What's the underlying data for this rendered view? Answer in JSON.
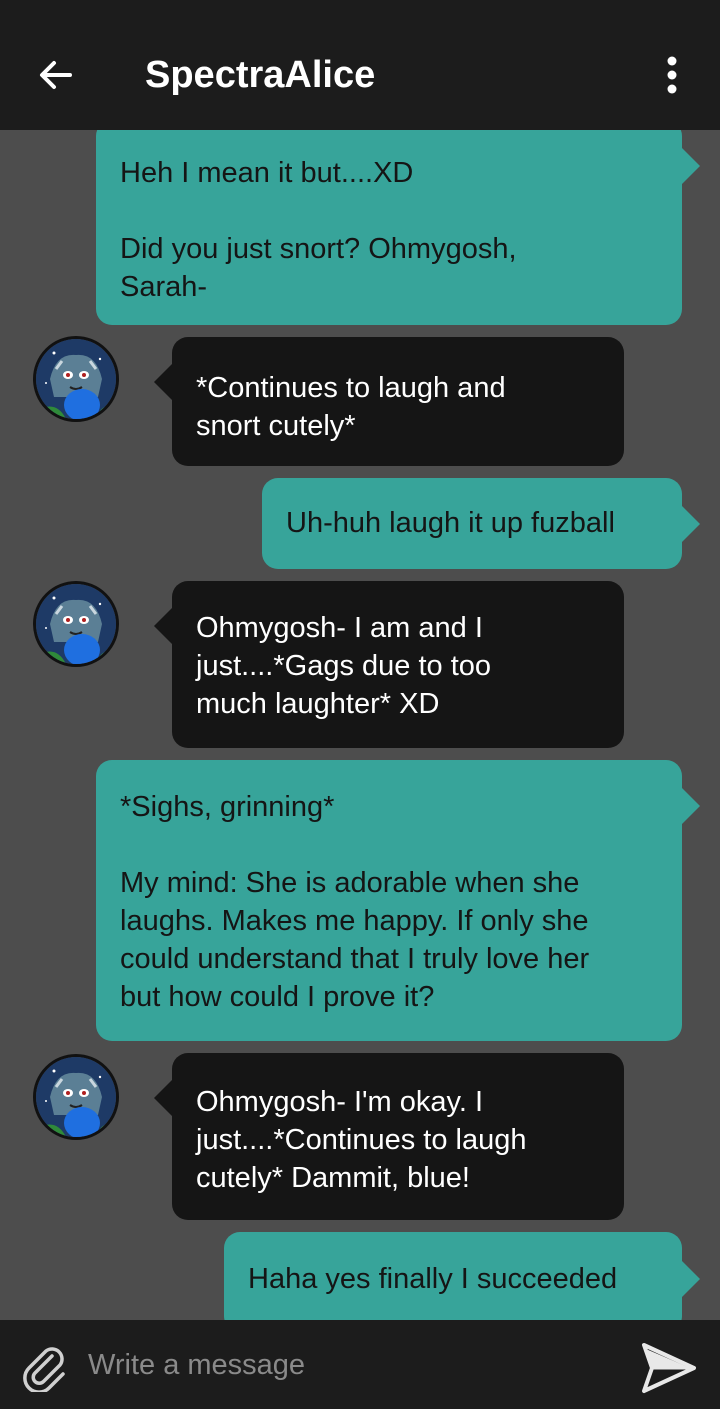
{
  "header": {
    "title": "SpectraAlice",
    "back_icon": "arrow-left-icon",
    "menu_icon": "more-vertical-icon"
  },
  "colors": {
    "header_bg": "#1c1c1c",
    "chat_bg": "#4d4d4d",
    "sent_bubble": "#37a49a",
    "received_bubble": "#151515"
  },
  "messages": [
    {
      "direction": "sent",
      "text": "Heh I mean it but....XD\n\nDid you just snort? Ohmygosh,\nSarah-"
    },
    {
      "direction": "received",
      "text": "*Continues to laugh and\nsnort cutely*"
    },
    {
      "direction": "sent",
      "text": "Uh-huh laugh it up fuzball"
    },
    {
      "direction": "received",
      "text": "Ohmygosh- I am and I\njust....*Gags due to too\nmuch laughter* XD"
    },
    {
      "direction": "sent",
      "text": "*Sighs, grinning*\n\nMy mind: She is adorable when she\nlaughs. Makes me happy. If only she\ncould understand that I truly love her\nbut how could I prove it?"
    },
    {
      "direction": "received",
      "text": "Ohmygosh- I'm okay. I\njust....*Continues to laugh\ncutely* Dammit, blue!"
    },
    {
      "direction": "sent",
      "text": "Haha yes finally I succeeded"
    }
  ],
  "composer": {
    "placeholder": "Write a message",
    "value": "",
    "attach_icon": "paperclip-icon",
    "send_icon": "send-icon"
  }
}
